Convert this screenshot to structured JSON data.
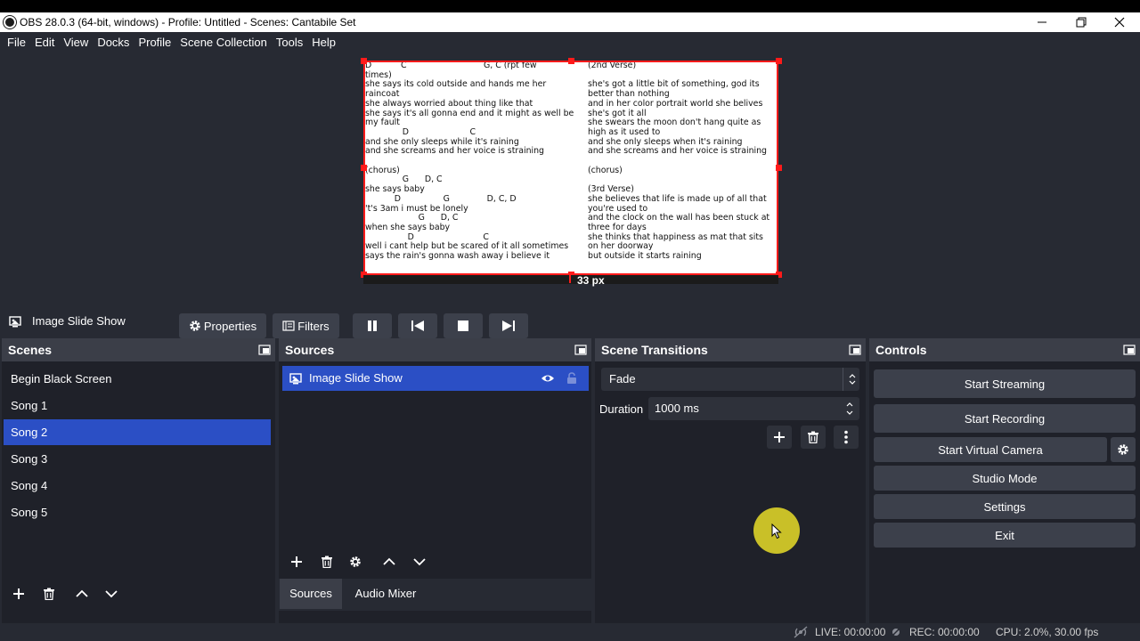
{
  "window": {
    "title": "OBS 28.0.3 (64-bit, windows) - Profile: Untitled - Scenes: Cantabile Set"
  },
  "menu": [
    "File",
    "Edit",
    "View",
    "Docks",
    "Profile",
    "Scene Collection",
    "Tools",
    "Help"
  ],
  "preview": {
    "lyrics_left": "D           C                             G, C (rpt few\ntimes)\nshe says its cold outside and hands me her\nraincoat\nshe always worried about thing like that\nshe says it's all gonna end and it might as well be\nmy fault\n              D                       C\nand she only sleeps while it's raining\nand she screams and her voice is straining\n\n(chorus)\n              G      D, C\nshe says baby\n           D                G              D, C, D\n't's 3am i must be lonely\n                    G      D, C\nwhen she says baby\n                D                          C\nwell i cant help but be scared of it all sometimes\nsays the rain's gonna wash away i believe it",
    "lyrics_right": "(2nd Verse)\n\nshe's got a little bit of something, god its\nbetter than nothing\nand in her color portrait world she belives\nshe's got it all\nshe swears the moon don't hang quite as\nhigh as it used to\nand she only sleeps when it's raining\nand she screams and her voice is straining\n\n(chorus)\n\n(3rd Verse)\nshe believes that life is made up of all that\nyou're used to\nand the clock on the wall has been stuck at\nthree for days\nshe thinks that happiness as mat that sits\non her doorway\nbut outside it starts raining",
    "measure_label": "33 px",
    "accent": "#ff1a1a"
  },
  "source_toolbar": {
    "current_source": "Image Slide Show",
    "properties_label": "Properties",
    "filters_label": "Filters"
  },
  "scenes": {
    "header": "Scenes",
    "items": [
      "Begin Black Screen",
      "Song 1",
      "Song 2",
      "Song 3",
      "Song 4",
      "Song 5"
    ],
    "selected": "Song 2",
    "selected_color": "#2b4fc5"
  },
  "sources": {
    "header": "Sources",
    "items": [
      {
        "name": "Image Slide Show",
        "icon": "slideshow-icon",
        "visible": true,
        "locked": false
      }
    ],
    "tabs": [
      "Sources",
      "Audio Mixer"
    ],
    "active_tab": "Sources"
  },
  "transitions": {
    "header": "Scene Transitions",
    "selected": "Fade",
    "duration_label": "Duration",
    "duration_value": "1000 ms"
  },
  "controls": {
    "header": "Controls",
    "buttons": [
      "Start Streaming",
      "Start Recording",
      "Start Virtual Camera",
      "Studio Mode",
      "Settings",
      "Exit"
    ]
  },
  "status": {
    "live": "LIVE: 00:00:00",
    "rec": "REC: 00:00:00",
    "cpu": "CPU: 2.0%, 30.00 fps"
  }
}
